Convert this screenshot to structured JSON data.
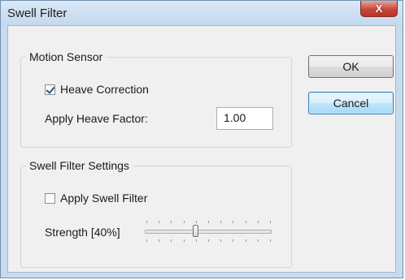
{
  "window": {
    "title": "Swell Filter",
    "close_glyph": "X"
  },
  "motion_sensor": {
    "legend": "Motion Sensor",
    "heave_correction": {
      "label": "Heave Correction",
      "checked": true
    },
    "heave_factor": {
      "label": "Apply Heave Factor:",
      "value": "1.00"
    }
  },
  "swell_filter": {
    "legend": "Swell Filter Settings",
    "apply": {
      "label": "Apply Swell Filter",
      "checked": false
    },
    "strength": {
      "label": "Strength [40%]",
      "value_fraction": 0.4
    }
  },
  "buttons": {
    "ok": "OK",
    "cancel": "Cancel"
  }
}
